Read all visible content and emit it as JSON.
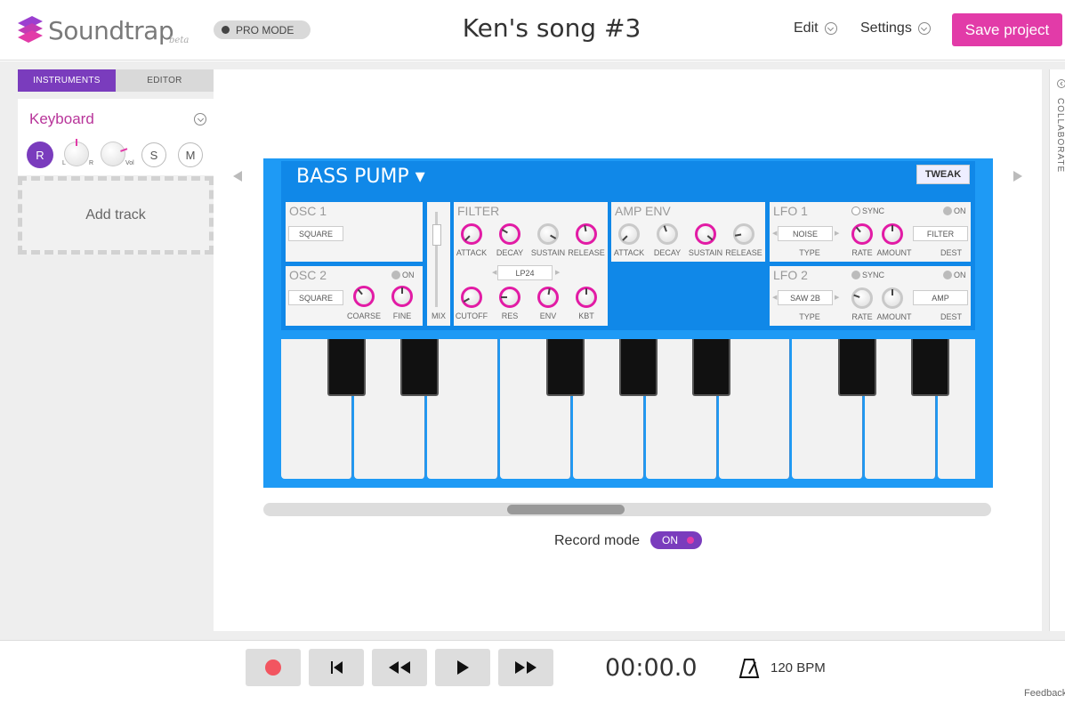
{
  "header": {
    "logo_text": "Soundtrap",
    "logo_beta": "beta",
    "pro_mode": "PRO MODE",
    "song_title": "Ken's song #3",
    "edit_label": "Edit",
    "settings_label": "Settings",
    "save_label": "Save project"
  },
  "left_panel": {
    "tabs": [
      {
        "label": "INSTRUMENTS"
      },
      {
        "label": "EDITOR"
      }
    ],
    "track": {
      "name": "Keyboard",
      "record": "R",
      "pan_left": "L",
      "pan_right": "R",
      "vol": "Vol",
      "solo": "S",
      "mute": "M"
    },
    "add_track": "Add track"
  },
  "synth": {
    "preset": "BASS PUMP ▾",
    "tweak": "TWEAK",
    "osc1": {
      "title": "OSC 1",
      "wave": "SQUARE"
    },
    "osc2": {
      "title": "OSC 2",
      "on": "ON",
      "wave": "SQUARE",
      "coarse": "COARSE",
      "fine": "FINE"
    },
    "mix": "MIX",
    "filter": {
      "title": "FILTER",
      "attack": "ATTACK",
      "decay": "DECAY",
      "sustain": "SUSTAIN",
      "release": "RELEASE",
      "type": "LP24",
      "cutoff": "CUTOFF",
      "res": "RES",
      "env": "ENV",
      "kbt": "KBT"
    },
    "amp_env": {
      "title": "AMP ENV",
      "attack": "ATTACK",
      "decay": "DECAY",
      "sustain": "SUSTAIN",
      "release": "RELEASE"
    },
    "lfo1": {
      "title": "LFO 1",
      "sync": "SYNC",
      "on": "ON",
      "wave": "NOISE",
      "dest": "FILTER",
      "type": "TYPE",
      "rate": "RATE",
      "amount": "AMOUNT",
      "dest_label": "DEST"
    },
    "lfo2": {
      "title": "LFO 2",
      "sync": "SYNC",
      "on": "ON",
      "wave": "SAW 2B",
      "dest": "AMP",
      "type": "TYPE",
      "rate": "RATE",
      "amount": "AMOUNT",
      "dest_label": "DEST"
    }
  },
  "record_mode": {
    "label": "Record mode",
    "value": "ON"
  },
  "collab": "COLLABORATE",
  "transport": {
    "time": "00:00.0",
    "bpm": "120 BPM"
  },
  "feedback": "Feedback",
  "colors": {
    "accent_purple": "#7a3cbd",
    "accent_pink": "#e23ba8",
    "synth_blue": "#1e9af5"
  }
}
